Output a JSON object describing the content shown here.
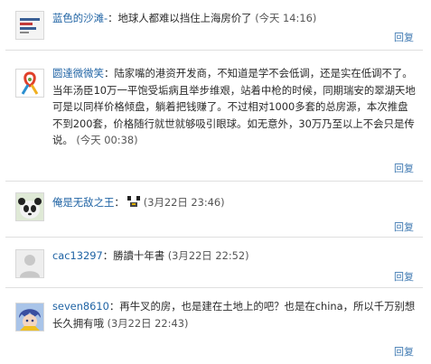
{
  "reply_label": "回复",
  "comments": [
    {
      "author": "蓝色的沙滩-",
      "text": "：地球人都难以挡住上海房价了",
      "time": "(今天 14:16)",
      "avatar": "logo-avatar"
    },
    {
      "author": "圆達微微笑",
      "text": "：陆家嘴的港资开发商，不知道是学不会低调，还是实在低调不了。当年汤臣10万一平饱受垢病且举步维艰，站着中枪的时候，同期瑞安的翠湖天地可是以同样价格倾盘，躺着把钱赚了。不过相对1000多套的总房源，本次推盘不到200套，价格随行就世就够吸引眼球。如无意外，30万乃至以上不会只是传说。",
      "time": "(今天 00:38)",
      "avatar": "ribbon-avatar"
    },
    {
      "author": "俺是无敌之王",
      "text": "：",
      "time": "(3月22日 23:46)",
      "avatar": "panda-avatar"
    },
    {
      "author": "cac13297",
      "text": "：勝讀十年書",
      "time": "(3月22日 22:52)",
      "avatar": "default-avatar"
    },
    {
      "author": "seven8610",
      "text": "：再牛叉的房，也是建在土地上的吧？也是在china，所以千万别想长久拥有哦",
      "time": "(3月22日 22:43)",
      "avatar": "anime-avatar"
    }
  ]
}
